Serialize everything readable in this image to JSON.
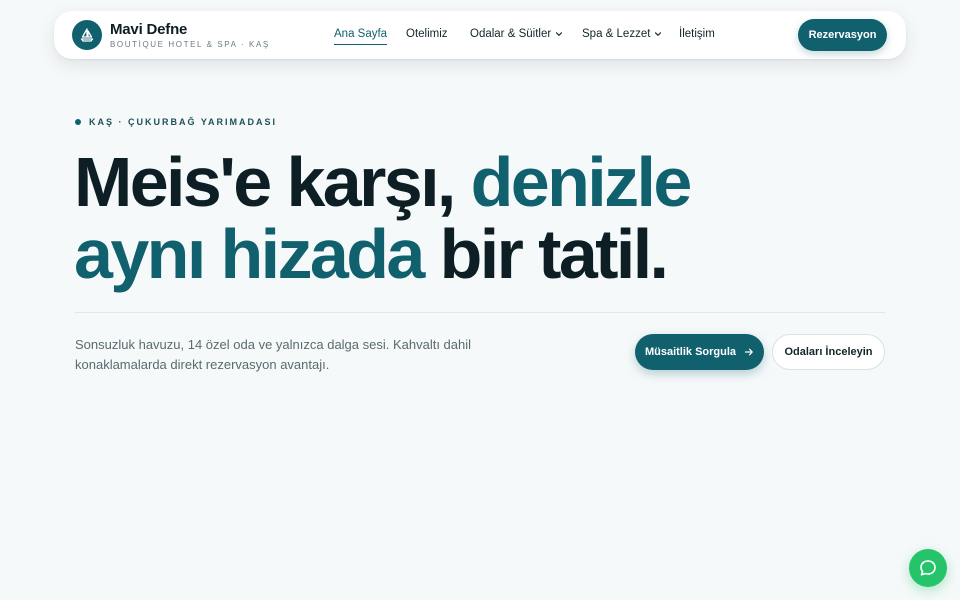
{
  "brand": {
    "name": "Mavi Defne",
    "subtitle": "BOUTİQUE HOTEL & SPA · KAŞ",
    "logo_icon": "sailboat-icon"
  },
  "nav": {
    "items": [
      {
        "label": "Ana Sayfa",
        "active": true
      },
      {
        "label": "Otelimiz"
      },
      {
        "label": "Odalar & Süitler",
        "has_dropdown": true
      },
      {
        "label": "Spa & Lezzet",
        "has_dropdown": true
      },
      {
        "label": "İletişim"
      }
    ],
    "cta_label": "Rezervasyon"
  },
  "hero": {
    "eyebrow": "KAŞ · ÇUKURBAĞ YARIMADASI",
    "headline": {
      "part1": "Meis'e karşı,",
      "accent1": "denizle",
      "accent2": "aynı hizada",
      "part2": "bir tatil."
    },
    "lede": "Sonsuzluk havuzu, 14 özel oda ve yalnızca dalga sesi. Kahvaltı dahil konaklamalarda direkt rezervasyon avantajı.",
    "primary_button": "Müsaitlik Sorgula",
    "secondary_button": "Odaları İnceleyin"
  },
  "chat": {
    "icon": "chat-bubble-icon"
  },
  "colors": {
    "brand_teal": "#11606e",
    "ink": "#0d1f24",
    "background": "#f6f9fa",
    "chat_green": "#25c46a"
  }
}
